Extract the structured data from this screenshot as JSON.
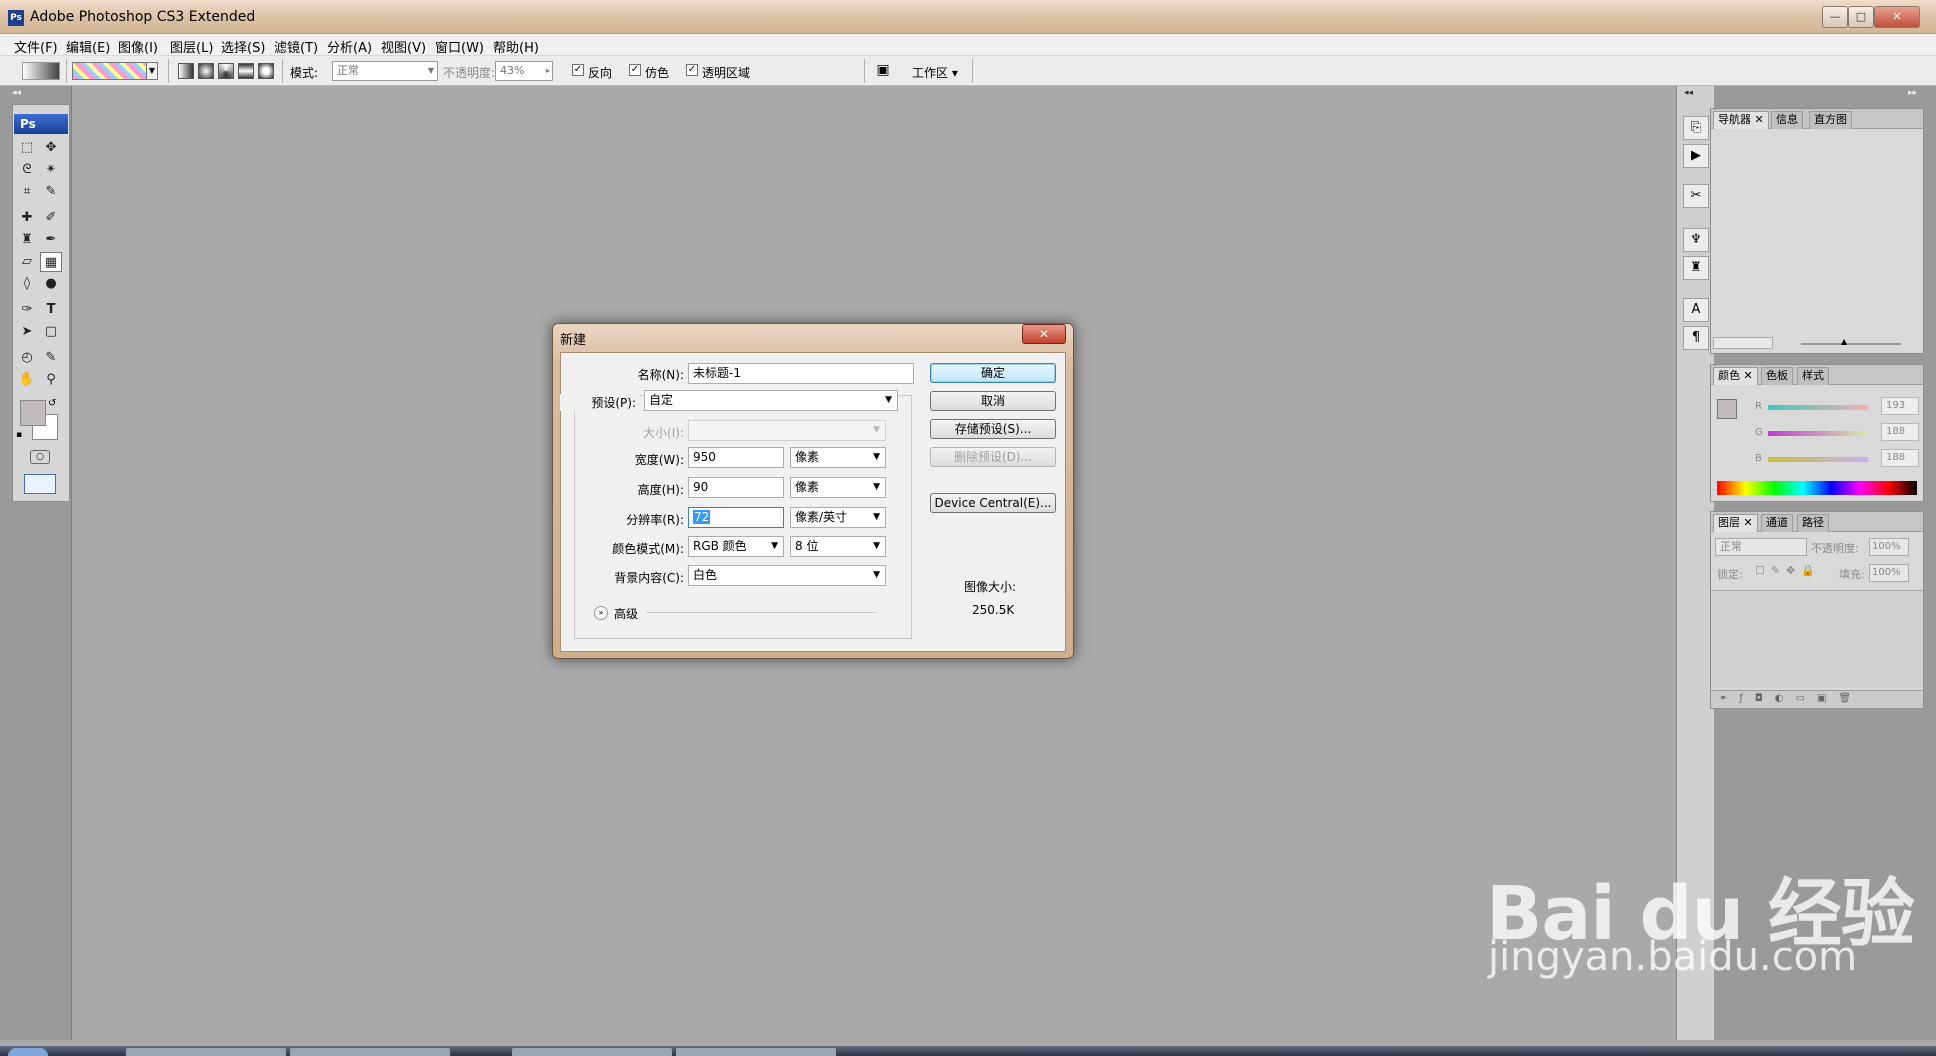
{
  "window": {
    "app_icon": "Ps",
    "title": "Adobe Photoshop CS3 Extended",
    "buttons": {
      "minimize": "—",
      "maximize": "□",
      "close": "✕"
    }
  },
  "menubar": [
    "文件(F)",
    "编辑(E)",
    "图像(I)",
    "图层(L)",
    "选择(S)",
    "滤镜(T)",
    "分析(A)",
    "视图(V)",
    "窗口(W)",
    "帮助(H)"
  ],
  "options": {
    "mode_label": "模式:",
    "mode_value": "正常",
    "opacity_label": "不透明度:",
    "opacity_value": "43%",
    "reverse_label": "反向",
    "dither_label": "仿色",
    "transparency_label": "透明区域",
    "workspace_label": "工作区"
  },
  "toolbox": {
    "badge": "Ps"
  },
  "panels": {
    "navigator_tabs": [
      "导航器",
      "信息",
      "直方图"
    ],
    "color_tabs": [
      "颜色",
      "色板",
      "样式"
    ],
    "color_values": {
      "R": "193",
      "G": "188",
      "B": "188"
    },
    "layers_tabs": [
      "图层",
      "通道",
      "路径"
    ],
    "layers_mode": "正常",
    "layers_opacity_label": "不透明度:",
    "layers_opacity": "100%",
    "layers_lock_label": "锁定:",
    "layers_fill_label": "填充:",
    "layers_fill": "100%"
  },
  "dialog": {
    "title": "新建",
    "close": "✕",
    "name_label": "名称(N):",
    "name_value": "未标题-1",
    "preset_label": "预设(P):",
    "preset_value": "自定",
    "size_label": "大小(I):",
    "width_label": "宽度(W):",
    "width_value": "950",
    "width_unit": "像素",
    "height_label": "高度(H):",
    "height_value": "90",
    "height_unit": "像素",
    "resolution_label": "分辨率(R):",
    "resolution_value": "72",
    "resolution_unit": "像素/英寸",
    "colormode_label": "颜色模式(M):",
    "colormode_value": "RGB 颜色",
    "bitdepth_value": "8 位",
    "background_label": "背景内容(C):",
    "background_value": "白色",
    "advanced_label": "高级",
    "ok": "确定",
    "cancel": "取消",
    "save_preset": "存储预设(S)...",
    "delete_preset": "删除预设(D)...",
    "device_central": "Device Central(E)...",
    "image_size_label": "图像大小:",
    "image_size_value": "250.5K"
  },
  "watermark": {
    "logo": "Bai du 经验",
    "url": "jingyan.baidu.com"
  }
}
